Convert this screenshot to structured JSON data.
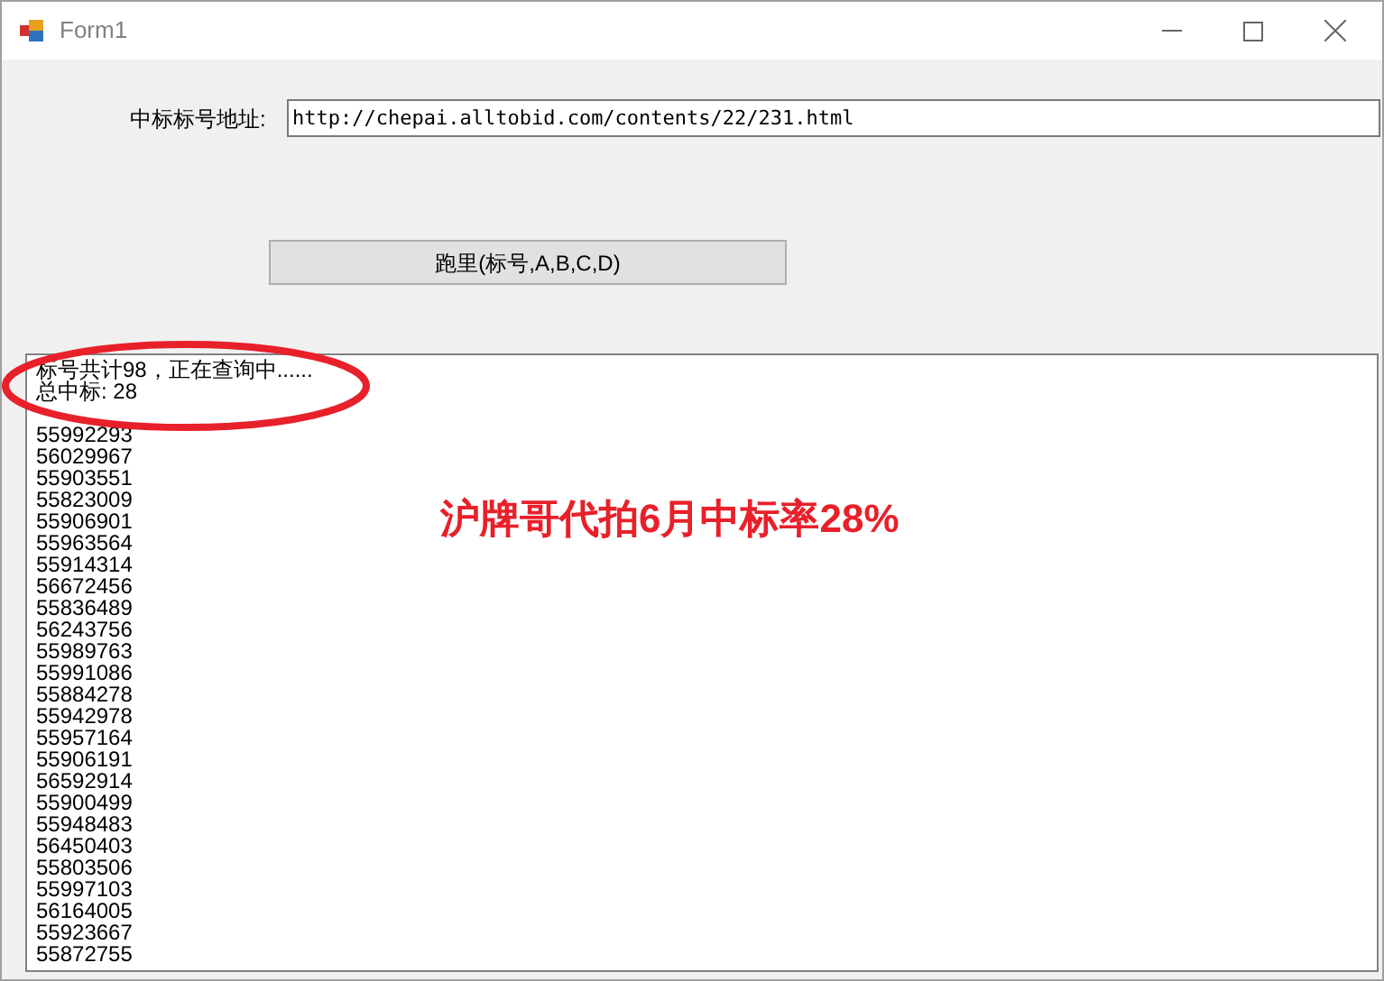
{
  "window": {
    "title": "Form1"
  },
  "address": {
    "label": "中标标号地址:",
    "value": "http://chepai.alltobid.com/contents/22/231.html"
  },
  "run_button": {
    "label": "跑里(标号,A,B,C,D)"
  },
  "output_lines": [
    "标号共计98，正在查询中......",
    "总中标: 28",
    "55992293",
    "56029967",
    "55903551",
    "55823009",
    "55906901",
    "55963564",
    "55914314",
    "56672456",
    "55836489",
    "56243756",
    "55989763",
    "55991086",
    "55884278",
    "55942978",
    "55957164",
    "55906191",
    "56592914",
    "55900499",
    "55948483",
    "56450403",
    "55803506",
    "55997103",
    "56164005",
    "55923667",
    "55872755"
  ],
  "overlay_caption": "沪牌哥代拍6月中标率28%"
}
